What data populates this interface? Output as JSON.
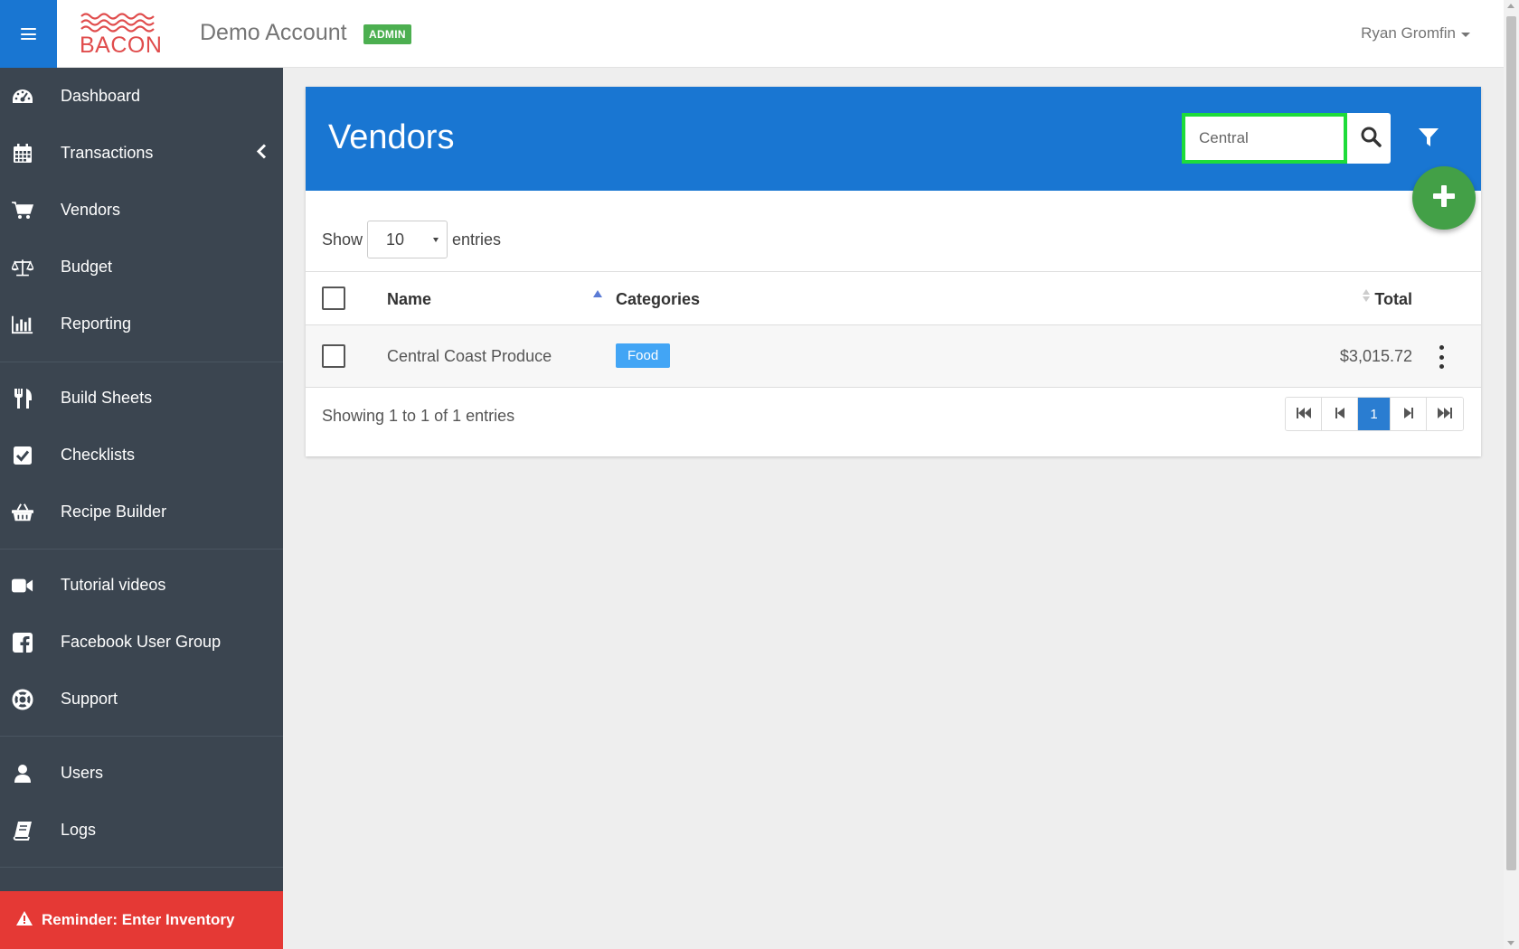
{
  "header": {
    "logo_text": "BACON",
    "account_name": "Demo Account",
    "badge": "ADMIN",
    "user_name": "Ryan Gromfin"
  },
  "sidebar": {
    "items": [
      {
        "label": "Dashboard",
        "icon": "dashboard-icon"
      },
      {
        "label": "Transactions",
        "icon": "calendar-icon"
      },
      {
        "label": "Vendors",
        "icon": "cart-icon"
      },
      {
        "label": "Budget",
        "icon": "scale-icon"
      },
      {
        "label": "Reporting",
        "icon": "bar-chart-icon"
      },
      {
        "label": "Build Sheets",
        "icon": "utensils-icon"
      },
      {
        "label": "Checklists",
        "icon": "check-square-icon"
      },
      {
        "label": "Recipe Builder",
        "icon": "basket-icon"
      },
      {
        "label": "Tutorial videos",
        "icon": "video-camera-icon"
      },
      {
        "label": "Facebook User Group",
        "icon": "facebook-icon"
      },
      {
        "label": "Support",
        "icon": "life-ring-icon"
      },
      {
        "label": "Users",
        "icon": "user-icon"
      },
      {
        "label": "Logs",
        "icon": "book-icon"
      }
    ],
    "reminder": "Reminder: Enter Inventory"
  },
  "page": {
    "title": "Vendors",
    "search_value": "Central"
  },
  "table": {
    "length_label_before": "Show",
    "length_value": "10",
    "length_label_after": "entries",
    "columns": [
      "Name",
      "Categories",
      "Total"
    ],
    "rows": [
      {
        "name": "Central Coast Produce",
        "category": "Food",
        "total": "$3,015.72"
      }
    ],
    "info": "Showing 1 to 1 of 1 entries",
    "current_page": "1"
  },
  "colors": {
    "primary": "#1976d2",
    "sidebar": "#3b4550",
    "admin_badge": "#4caf50",
    "fab": "#43a047",
    "reminder": "#e53935",
    "category_tag": "#42a5f5",
    "search_highlight": "#1ddb3a"
  }
}
